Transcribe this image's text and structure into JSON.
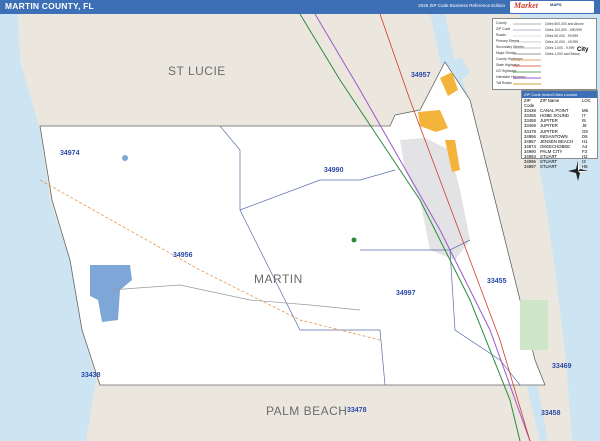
{
  "header": {
    "title": "MARTIN COUNTY, FL",
    "subtitle": "2025 ZIP Code Business Reference Edition",
    "logo_text": "Market",
    "logo_sub": "MAPS"
  },
  "map_labels": {
    "counties": {
      "st_lucie": "ST LUCIE",
      "martin": "MARTIN",
      "palm_beach": "PALM BEACH"
    },
    "zips": {
      "z34957": "34957",
      "z34974": "34974",
      "z34990": "34990",
      "z34956": "34956",
      "z34997": "34997",
      "z33455": "33455",
      "z33438": "33438",
      "z33478": "33478",
      "z33469": "33469",
      "z33458": "33458"
    }
  },
  "legend": {
    "items": [
      "County",
      "ZIP Code",
      "Roads",
      "Primary Streets",
      "Secondary Streets",
      "Major Streets",
      "County Highways",
      "State Highways",
      "US Highways",
      "Interstate Highways",
      "Toll Roads"
    ],
    "right_items": [
      "Cities 500,000 and Above",
      "Cities 100,000 - 499,999",
      "Cities 50,000 - 99,999",
      "Cities 10,000 - 49,999",
      "Cities 1,000 - 9,999",
      "Cities 1,000 and Below"
    ],
    "city_sample": "City"
  },
  "zip_index": {
    "title": "ZIP Code Index/Cities Locator",
    "headers": [
      "ZIP Code",
      "ZIP Name",
      "LOC"
    ],
    "rows": [
      [
        "33438",
        "CANAL POINT",
        "M6"
      ],
      [
        "33455",
        "HOBE SOUND",
        "I7"
      ],
      [
        "33458",
        "JUPITER",
        "I9"
      ],
      [
        "33469",
        "JUPITER",
        "J8"
      ],
      [
        "33478",
        "JUPITER",
        "G8"
      ],
      [
        "34956",
        "INDIANTOWN",
        "D6"
      ],
      [
        "34957",
        "JENSEN BEACH",
        "H1"
      ],
      [
        "34974",
        "OKEECHOBEE",
        "A4"
      ],
      [
        "34990",
        "PALM CITY",
        "F3"
      ],
      [
        "34994",
        "STUART",
        "H2"
      ],
      [
        "34996",
        "STUART",
        "I3"
      ],
      [
        "34997",
        "STUART",
        "H5"
      ]
    ]
  },
  "colors": {
    "title_bar": "#3d6fb6",
    "water": "#cde4f2",
    "outside_county": "#ebe7df",
    "county_fill": "#ffffff",
    "zip_text": "#2a4aa8",
    "city_fill": "#f4b33a"
  }
}
